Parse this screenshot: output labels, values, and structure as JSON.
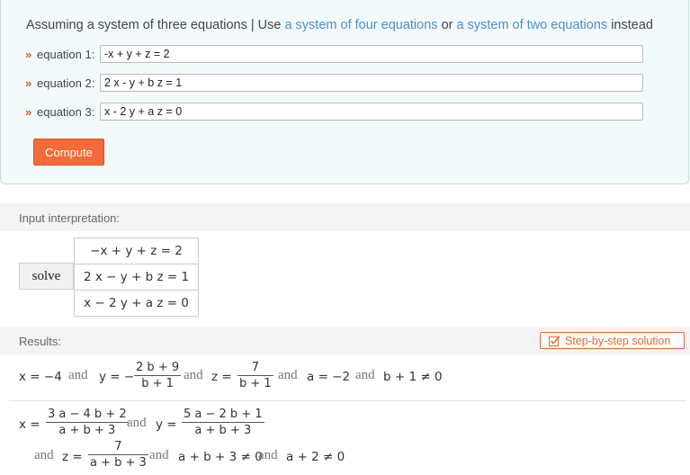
{
  "assumption": {
    "prefix": "Assuming a system of three equations | Use",
    "link1": "a system of four equations",
    "middle": "or",
    "link2": "a system of two equations",
    "suffix": "instead"
  },
  "equations": [
    {
      "label": "equation 1:",
      "value": "-x + y + z = 2"
    },
    {
      "label": "equation 2:",
      "value": "2 x - y + b z = 1"
    },
    {
      "label": "equation 3:",
      "value": "x - 2 y + a z = 0"
    }
  ],
  "compute_label": "Compute",
  "input_interpretation": {
    "title": "Input interpretation:",
    "solve": "solve",
    "rows": [
      "−x + y + z = 2",
      "2 x − y + b z = 1",
      "x − 2 y + a z = 0"
    ]
  },
  "results": {
    "title": "Results:",
    "step_label": "Step-by-step solution",
    "and_word": "and",
    "r1": {
      "x": "x = −4",
      "y_lhs": "y = −",
      "y_num": "2 b + 9",
      "y_den": "b + 1",
      "z_lhs": "z =",
      "z_num": "7",
      "z_den": "b + 1",
      "a_cond": "a = −2",
      "b_cond": "b + 1 ≠ 0"
    },
    "r2": {
      "x_lhs": "x =",
      "x_num": "3 a − 4 b + 2",
      "x_den": "a + b + 3",
      "y_lhs": "y =",
      "y_num": "5 a − 2 b + 1",
      "y_den": "a + b + 3",
      "z_lhs": "z =",
      "z_num": "7",
      "z_den": "a + b + 3",
      "cond1": "a + b + 3 ≠ 0",
      "cond2": "a + 2 ≠ 0"
    }
  }
}
